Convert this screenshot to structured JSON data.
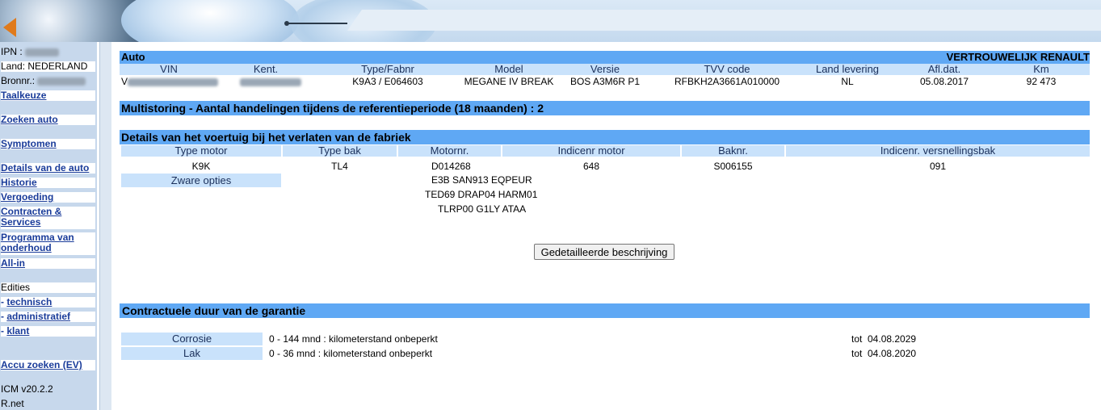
{
  "sidebar": {
    "ipn_label": "IPN : ",
    "land": "Land: NEDERLAND",
    "bronnr_label": "Bronnr.:",
    "taalkeuze": "Taalkeuze",
    "zoeken_auto": "Zoeken auto",
    "symptomen": "Symptomen",
    "details": "Details van de auto",
    "historie": "Historie",
    "vergoeding": "Vergoeding",
    "contracten": "Contracten &",
    "services": "Services",
    "programma": "Programma van",
    "onderhoud": "onderhoud",
    "all_in": "All-in",
    "edities": "Edities",
    "prefix": "- ",
    "technisch": "technisch",
    "administratief": "administratief",
    "klant": "klant",
    "accu": "Accu zoeken (EV)",
    "version": "ICM v20.2.2",
    "rnet": "R.net"
  },
  "auto": {
    "title": "Auto",
    "confidential": "VERTROUWELIJK RENAULT",
    "headers": [
      "VIN",
      "Kent.",
      "Type/Fabnr",
      "Model",
      "Versie",
      "TVV code",
      "Land levering",
      "Afl.dat.",
      "Km"
    ],
    "values": [
      "",
      "",
      "K9A3 / E064603",
      "MEGANE IV BREAK",
      "BOS A3M6R P1",
      "RFBKH2A3661A010000",
      "NL",
      "05.08.2017",
      "92 473"
    ],
    "vin_prefix": "V"
  },
  "multistoring": "Multistoring - Aantal handelingen tijdens de referentieperiode (18 maanden) : 2",
  "details": {
    "title": "Details van het voertuig bij het verlaten van de fabriek",
    "headers": [
      "Type motor",
      "Type bak",
      "Motornr.",
      "Indicenr motor",
      "Baknr.",
      "Indicenr. versnellingsbak"
    ],
    "values": [
      "K9K",
      "TL4",
      "D014268",
      "648",
      "S006155",
      "091"
    ],
    "options_label": "Zware opties",
    "options": [
      "E3B SAN913 EQPEUR",
      "TED69 DRAP04 HARM01",
      "TLRP00 G1LY ATAA"
    ],
    "button": "Gedetailleerde beschrijving"
  },
  "garantie": {
    "title": "Contractuele duur van de garantie",
    "rows": [
      {
        "label": "Corrosie",
        "desc": "0 - 144 mnd : kilometerstand onbeperkt",
        "tot": "tot  04.08.2029"
      },
      {
        "label": "Lak",
        "desc": "0 - 36 mnd : kilometerstand onbeperkt",
        "tot": "tot  04.08.2020"
      }
    ]
  }
}
